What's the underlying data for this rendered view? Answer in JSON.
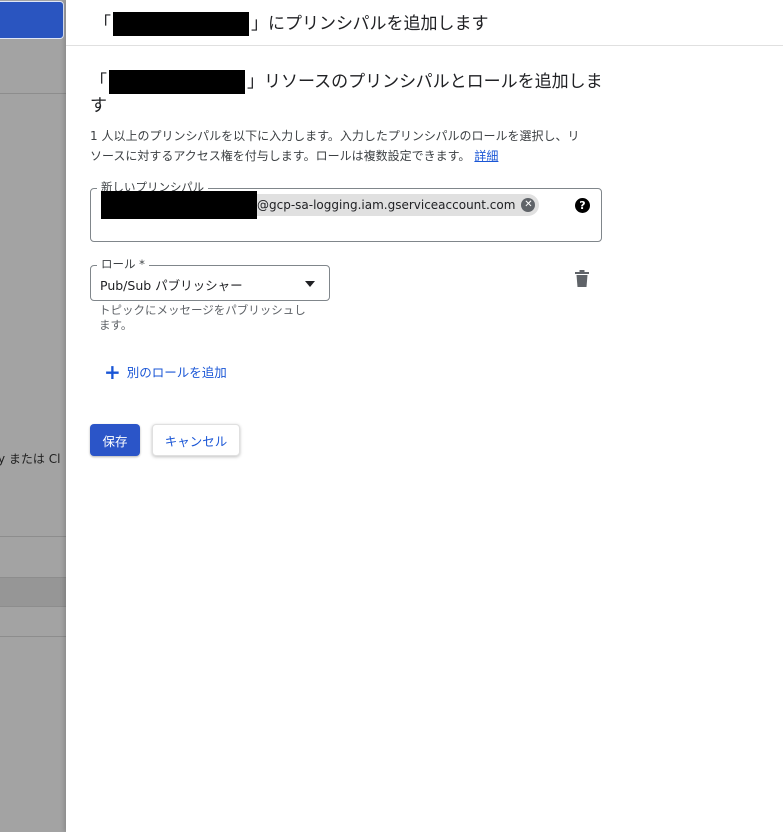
{
  "background": {
    "partial_text": "y または Cl"
  },
  "panel": {
    "header": {
      "open_quote": "「",
      "close_suffix": "」にプリンシパルを追加します"
    },
    "section": {
      "open_quote": "「",
      "title_suffix": "」リソースのプリンシパルとロールを追加します"
    },
    "description": "1 人以上のプリンシパルを以下に入力します。入力したプリンシパルのロールを選択し、リソースに対するアクセス権を付与します。ロールは複数設定できます。",
    "details_link": "詳細",
    "principal_field": {
      "label": "新しいプリンシパル",
      "chip_text": "@gcp-sa-logging.iam.gserviceaccount.com",
      "help_icon": "?"
    },
    "role_field": {
      "label": "ロール *",
      "value": "Pub/Sub パブリッシャー",
      "hint": "トピックにメッセージをパブリッシュします。"
    },
    "add_role_label": "別のロールを追加",
    "buttons": {
      "save": "保存",
      "cancel": "キャンセル"
    }
  },
  "colors": {
    "primary": "#2b55c8",
    "link": "#1a56d6",
    "overlay": "#a3a3a3"
  }
}
